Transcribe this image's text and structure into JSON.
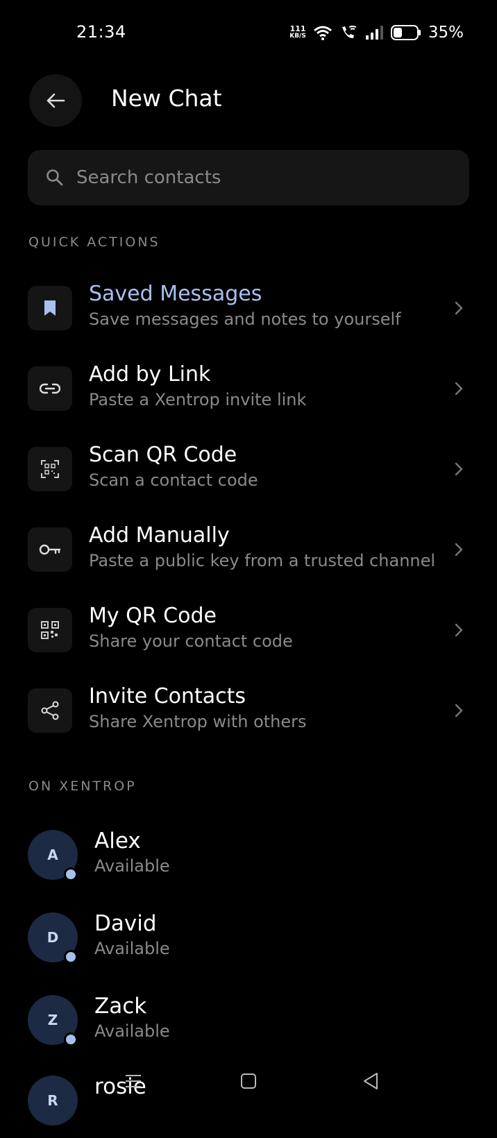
{
  "status_bar": {
    "time": "21:34",
    "net_speed_value": "111",
    "net_speed_unit": "KB/S",
    "battery_percent": "35%"
  },
  "header": {
    "title": "New Chat"
  },
  "search": {
    "placeholder": "Search contacts"
  },
  "sections": {
    "quick_actions": "QUICK ACTIONS",
    "on_xentrop": "ON XENTROP"
  },
  "quick_actions": [
    {
      "icon": "bookmark-icon",
      "title": "Saved Messages",
      "subtitle": "Save messages and notes to yourself"
    },
    {
      "icon": "link-icon",
      "title": "Add by Link",
      "subtitle": "Paste a Xentrop invite link"
    },
    {
      "icon": "scan-qr-icon",
      "title": "Scan QR Code",
      "subtitle": "Scan a contact code"
    },
    {
      "icon": "key-icon",
      "title": "Add Manually",
      "subtitle": "Paste a public key from a trusted channel"
    },
    {
      "icon": "qr-code-icon",
      "title": "My QR Code",
      "subtitle": "Share your contact code"
    },
    {
      "icon": "share-icon",
      "title": "Invite Contacts",
      "subtitle": "Share Xentrop with others"
    }
  ],
  "contacts": [
    {
      "initial": "A",
      "name": "Alex",
      "status": "Available"
    },
    {
      "initial": "D",
      "name": "David",
      "status": "Available"
    },
    {
      "initial": "Z",
      "name": "Zack",
      "status": "Available"
    },
    {
      "initial": "R",
      "name": "rosie",
      "status": ""
    }
  ],
  "colors": {
    "accent": "#a9c0ee",
    "background": "#000000",
    "surface": "#151515",
    "muted_text": "#8a8a8a",
    "avatar_bg": "#1c2a44"
  }
}
